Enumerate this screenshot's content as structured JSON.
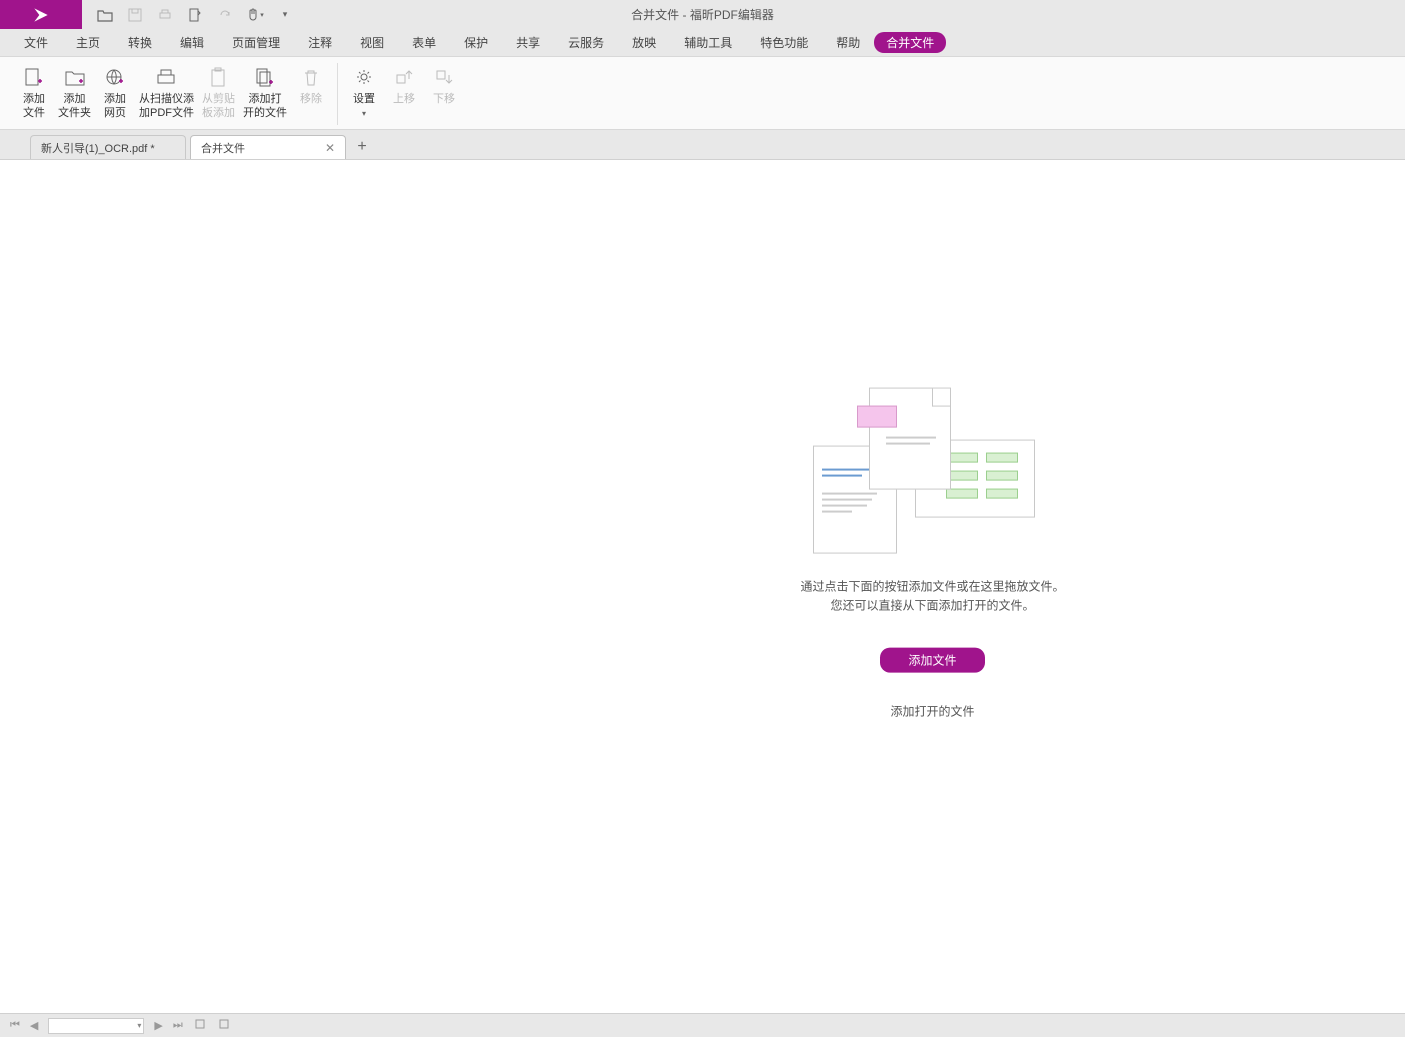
{
  "title": {
    "doc": "合并文件",
    "app": "福昕PDF编辑器"
  },
  "menu": {
    "file": "文件",
    "home": "主页",
    "convert": "转换",
    "edit": "编辑",
    "pagemgmt": "页面管理",
    "annotate": "注释",
    "view": "视图",
    "form": "表单",
    "protect": "保护",
    "share": "共享",
    "cloud": "云服务",
    "slideshow": "放映",
    "accessibility": "辅助工具",
    "features": "特色功能",
    "help": "帮助",
    "merge": "合并文件"
  },
  "ribbon": {
    "addfile": "添加\n文件",
    "addfolder": "添加\n文件夹",
    "addweb": "添加\n网页",
    "addscan": "从扫描仪添\n加PDF文件",
    "addclip": "从剪贴\n板添加",
    "addopen": "添加打\n开的文件",
    "remove": "移除",
    "settings": "设置",
    "moveup": "上移",
    "movedown": "下移"
  },
  "tabs": {
    "t1": "新人引导(1)_OCR.pdf *",
    "t2": "合并文件"
  },
  "empty": {
    "line1": "通过点击下面的按钮添加文件或在这里拖放文件。",
    "line2": "您还可以直接从下面添加打开的文件。",
    "addbtn": "添加文件",
    "addopen": "添加打开的文件"
  }
}
